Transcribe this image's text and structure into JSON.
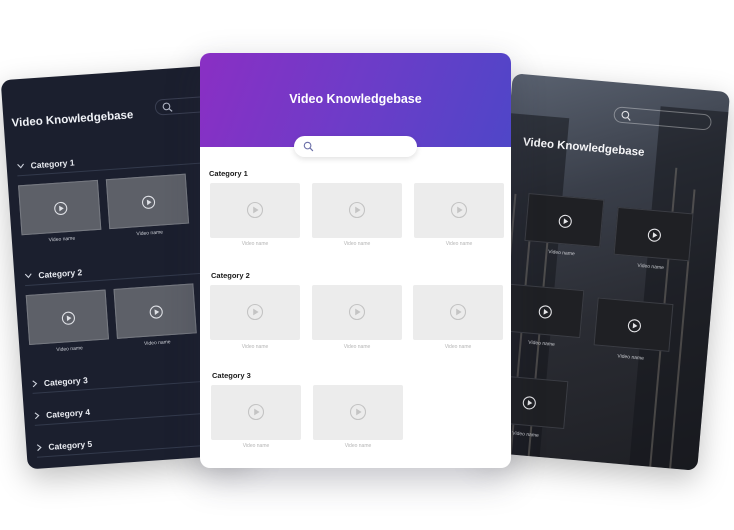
{
  "left_card": {
    "title": "Video Knowledgebase",
    "categories": [
      {
        "label": "Category 1",
        "expanded": true
      },
      {
        "label": "Category 2",
        "expanded": true
      },
      {
        "label": "Category 3",
        "expanded": false
      },
      {
        "label": "Category 4",
        "expanded": false
      },
      {
        "label": "Category 5",
        "expanded": false
      }
    ],
    "video_name": "Video name"
  },
  "center_card": {
    "title": "Video Knowledgebase",
    "search_placeholder": "",
    "categories": [
      {
        "label": "Category 1",
        "videos": [
          "Video name",
          "Video name",
          "Video name"
        ]
      },
      {
        "label": "Category 2",
        "videos": [
          "Video name",
          "Video name",
          "Video name"
        ]
      },
      {
        "label": "Category 3",
        "videos": [
          "Video name",
          "Video name"
        ]
      }
    ],
    "colors": {
      "header_start": "#8a2fc4",
      "header_end": "#4f46c8"
    }
  },
  "right_card": {
    "title": "Video Knowledgebase",
    "video_name": "Video name"
  },
  "icons": {
    "search": "search-icon",
    "play": "play-icon",
    "chevron_down": "chevron-down-icon",
    "chevron_right": "chevron-right-icon"
  }
}
